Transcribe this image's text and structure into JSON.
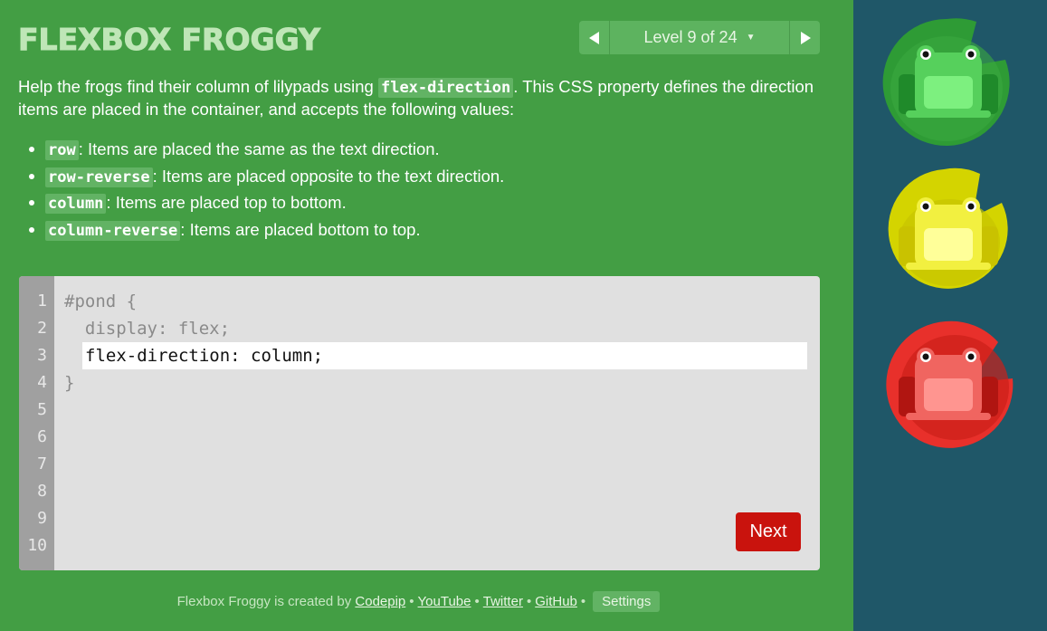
{
  "app": {
    "title": "FLEXBOX FROGGY"
  },
  "level": {
    "label": "Level 9 of 24",
    "prev_icon": "triangle-left-icon",
    "next_icon": "triangle-right-icon"
  },
  "instructions": {
    "before": "Help the frogs find their column of lilypads using ",
    "property": "flex-direction",
    "after": ". This CSS property defines the direction items are placed in the container, and accepts the following values:"
  },
  "values": [
    {
      "code": "row",
      "desc": ": Items are placed the same as the text direction."
    },
    {
      "code": "row-reverse",
      "desc": ": Items are placed opposite to the text direction."
    },
    {
      "code": "column",
      "desc": ": Items are placed top to bottom."
    },
    {
      "code": "column-reverse",
      "desc": ": Items are placed bottom to top."
    }
  ],
  "editor": {
    "line_numbers": [
      "1",
      "2",
      "3",
      "4",
      "5",
      "6",
      "7",
      "8",
      "9",
      "10"
    ],
    "line1": "#pond {",
    "line2": "  display: flex;",
    "input_value": "flex-direction: column;",
    "line4": "}",
    "next_label": "Next"
  },
  "footer": {
    "prefix": "Flexbox Froggy is created by",
    "links": [
      "Codepip",
      "YouTube",
      "Twitter",
      "GitHub"
    ],
    "settings_label": "Settings"
  },
  "colors": {
    "green_frog": "#2e9b35",
    "yellow_frog": "#d4d400",
    "red_frog": "#d8211f",
    "board": "#1f5768",
    "sidebar": "#439e44"
  }
}
